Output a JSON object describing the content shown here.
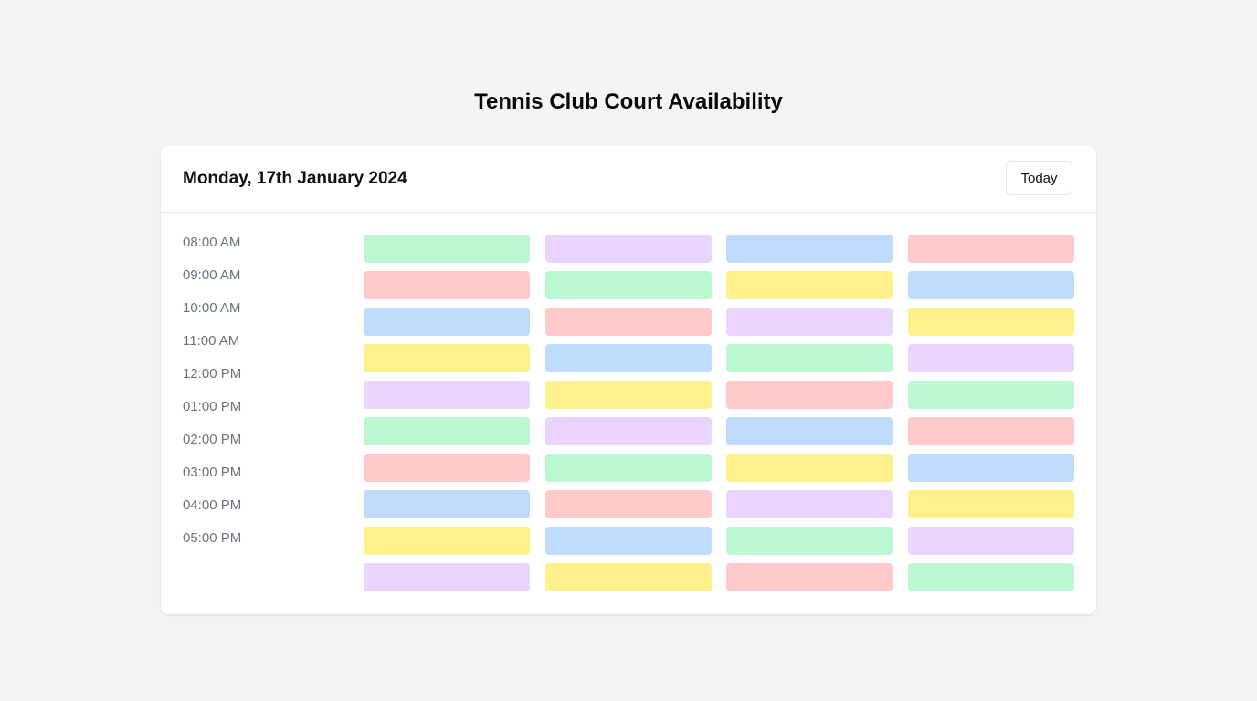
{
  "page_title": "Tennis Club Court Availability",
  "date_label": "Monday, 17th January 2024",
  "today_button_label": "Today",
  "time_labels": [
    "08:00 AM",
    "09:00 AM",
    "10:00 AM",
    "11:00 AM",
    "12:00 PM",
    "01:00 PM",
    "02:00 PM",
    "03:00 PM",
    "04:00 PM",
    "05:00 PM"
  ],
  "colors": {
    "green": "#bbf7d0",
    "purple": "#e9d5ff",
    "blue": "#bfdbfe",
    "red": "#fecaca",
    "yellow": "#fef08a"
  },
  "slot_rows": [
    [
      "green",
      "purple",
      "blue",
      "red"
    ],
    [
      "red",
      "green",
      "yellow",
      "blue"
    ],
    [
      "blue",
      "red",
      "purple",
      "yellow"
    ],
    [
      "yellow",
      "blue",
      "green",
      "purple"
    ],
    [
      "purple",
      "yellow",
      "red",
      "green"
    ],
    [
      "green",
      "purple",
      "blue",
      "red"
    ],
    [
      "red",
      "green",
      "yellow",
      "blue"
    ],
    [
      "blue",
      "red",
      "purple",
      "yellow"
    ],
    [
      "yellow",
      "blue",
      "green",
      "purple"
    ],
    [
      "purple",
      "yellow",
      "red",
      "green"
    ]
  ]
}
